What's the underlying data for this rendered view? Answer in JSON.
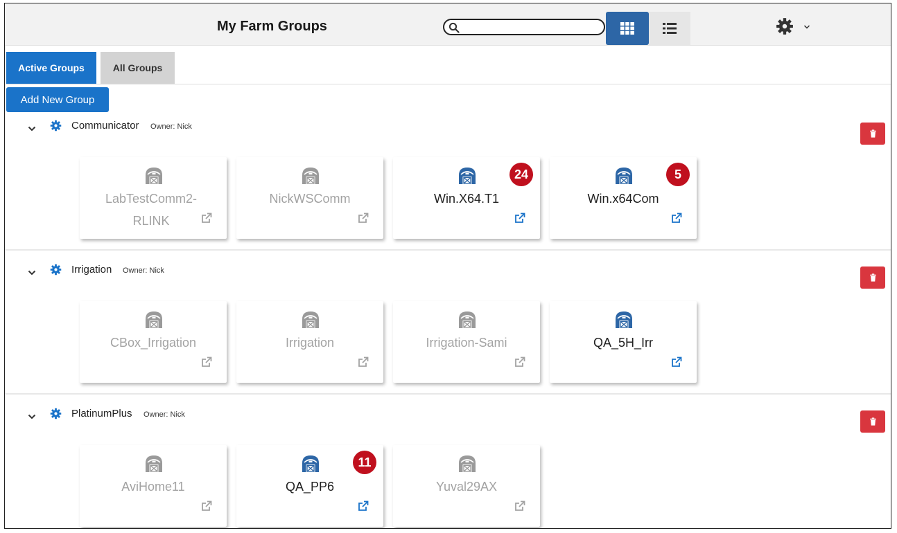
{
  "header": {
    "title": "My Farm Groups",
    "search_placeholder": "",
    "search_value": ""
  },
  "tabs": {
    "active_label": "Active Groups",
    "all_label": "All Groups"
  },
  "add_button_label": "Add New Group",
  "colors": {
    "primary": "#1a73c9",
    "danger": "#d9363e",
    "badge": "#c0101e",
    "barn_active": "#2d66a6",
    "barn_inactive": "#9a9a9a"
  },
  "icons": [
    "search-icon",
    "grid-view-icon",
    "list-view-icon",
    "gear-icon",
    "chevron-down-icon",
    "barn-icon",
    "external-link-icon",
    "trash-icon"
  ],
  "groups": [
    {
      "name": "Communicator",
      "owner": "Owner: Nick",
      "farms": [
        {
          "name": "LabTestComm2-RLINK",
          "line1": "LabTestComm2-",
          "line2": "RLINK",
          "active": false,
          "badge": ""
        },
        {
          "name": "NickWSComm",
          "active": false,
          "badge": ""
        },
        {
          "name": "Win.X64.T1",
          "active": true,
          "badge": "24"
        },
        {
          "name": "Win.x64Com",
          "active": true,
          "badge": "5"
        }
      ]
    },
    {
      "name": "Irrigation",
      "owner": "Owner: Nick",
      "farms": [
        {
          "name": "CBox_Irrigation",
          "active": false,
          "badge": ""
        },
        {
          "name": "Irrigation",
          "active": false,
          "badge": ""
        },
        {
          "name": "Irrigation-Sami",
          "active": false,
          "badge": ""
        },
        {
          "name": "QA_5H_Irr",
          "active": true,
          "badge": ""
        }
      ]
    },
    {
      "name": "PlatinumPlus",
      "owner": "Owner: Nick",
      "farms": [
        {
          "name": "AviHome11",
          "active": false,
          "badge": ""
        },
        {
          "name": "QA_PP6",
          "active": true,
          "badge": "11"
        },
        {
          "name": "Yuval29AX",
          "active": false,
          "badge": ""
        }
      ]
    }
  ]
}
